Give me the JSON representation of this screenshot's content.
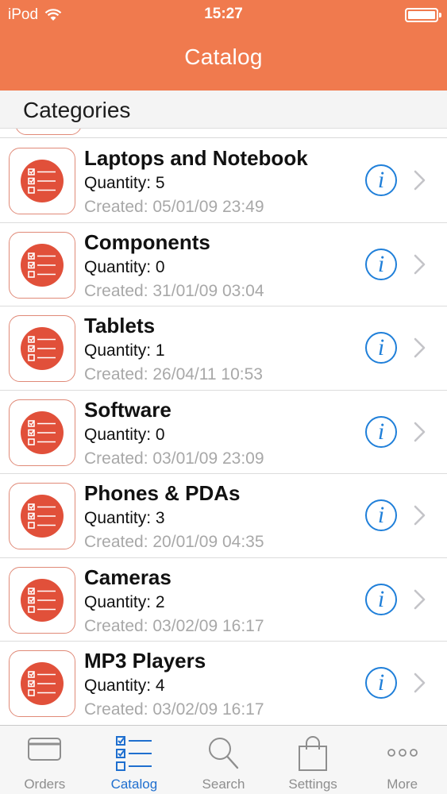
{
  "status_bar": {
    "carrier": "iPod",
    "time": "15:27"
  },
  "nav": {
    "title": "Catalog"
  },
  "section": {
    "title": "Categories"
  },
  "categories": [
    {
      "name": "Laptops and Notebook",
      "quantity": "Quantity: 5",
      "created": "Created: 05/01/09 23:49"
    },
    {
      "name": "Components",
      "quantity": "Quantity: 0",
      "created": "Created: 31/01/09 03:04"
    },
    {
      "name": "Tablets",
      "quantity": "Quantity: 1",
      "created": "Created: 26/04/11 10:53"
    },
    {
      "name": "Software",
      "quantity": "Quantity: 0",
      "created": "Created: 03/01/09 23:09"
    },
    {
      "name": "Phones & PDAs",
      "quantity": "Quantity: 3",
      "created": "Created: 20/01/09 04:35"
    },
    {
      "name": "Cameras",
      "quantity": "Quantity: 2",
      "created": "Created: 03/02/09 16:17"
    },
    {
      "name": "MP3 Players",
      "quantity": "Quantity: 4",
      "created": "Created: 03/02/09 16:17"
    }
  ],
  "tabs": [
    {
      "label": "Orders",
      "icon": "card-icon",
      "active": false
    },
    {
      "label": "Catalog",
      "icon": "checklist-icon",
      "active": true
    },
    {
      "label": "Search",
      "icon": "magnifier-icon",
      "active": false
    },
    {
      "label": "Settings",
      "icon": "shopping-bag-icon",
      "active": false
    },
    {
      "label": "More",
      "icon": "more-dots-icon",
      "active": false
    }
  ],
  "colors": {
    "accent": "#f07a4e",
    "icon_red": "#e1503a",
    "info_blue": "#1f7fd9",
    "tab_active": "#1f6fcf"
  }
}
